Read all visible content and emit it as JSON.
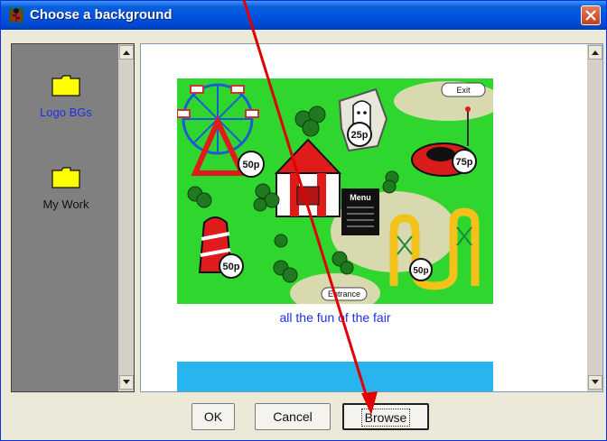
{
  "window": {
    "title": "Choose a background",
    "title_icon": "ladybug-icon",
    "close_icon": "close-icon"
  },
  "left_panel": {
    "items": [
      {
        "label": "Logo BGs",
        "icon": "folder-icon",
        "selected": true
      },
      {
        "label": "My Work",
        "icon": "folder-icon",
        "selected": false
      }
    ]
  },
  "preview": {
    "items": [
      {
        "caption": "all the fun of the fair",
        "image_text": {
          "exit": "Exit",
          "entrance": "Entrance",
          "menu": "Menu",
          "price_ferris": "50p",
          "price_ghost": "25p",
          "price_dodgem": "75p",
          "price_helter": "50p",
          "price_coaster": "50p"
        }
      }
    ]
  },
  "buttons": {
    "ok": "OK",
    "cancel": "Cancel",
    "browse": "Browse"
  },
  "colors": {
    "title_bar": "#0054e3",
    "link_text": "#1d2fe6",
    "annotation_arrow": "#e00000",
    "fair_grass": "#2ed62e"
  }
}
